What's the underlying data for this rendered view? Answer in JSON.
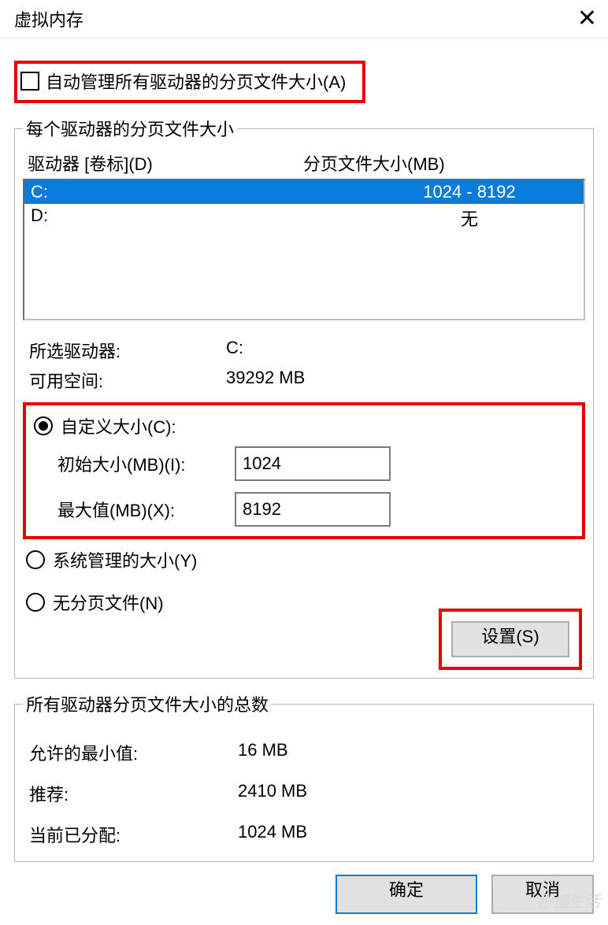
{
  "window": {
    "title": "虚拟内存",
    "close": "✕"
  },
  "auto_manage": {
    "checked": false,
    "label": "自动管理所有驱动器的分页文件大小(A)"
  },
  "per_drive_group": {
    "legend": "每个驱动器的分页文件大小",
    "header_drive": "驱动器 [卷标](D)",
    "header_size": "分页文件大小(MB)",
    "rows": [
      {
        "drive": "C:",
        "size": "1024 - 8192",
        "selected": true
      },
      {
        "drive": "D:",
        "size": "无",
        "selected": false
      }
    ],
    "selected_label": "所选驱动器:",
    "selected_value": "C:",
    "free_label": "可用空间:",
    "free_value": "39292 MB",
    "custom": {
      "radio_label": "自定义大小(C):",
      "init_label": "初始大小(MB)(I):",
      "init_value": "1024",
      "max_label": "最大值(MB)(X):",
      "max_value": "8192"
    },
    "system_managed": "系统管理的大小(Y)",
    "no_paging": "无分页文件(N)",
    "set_button": "设置(S)"
  },
  "totals_group": {
    "legend": "所有驱动器分页文件大小的总数",
    "min_label": "允许的最小值:",
    "min_value": "16 MB",
    "rec_label": "推荐:",
    "rec_value": "2410 MB",
    "cur_label": "当前已分配:",
    "cur_value": "1024 MB"
  },
  "footer": {
    "ok": "确定",
    "cancel": "取消"
  },
  "watermark": "秒懂生活"
}
